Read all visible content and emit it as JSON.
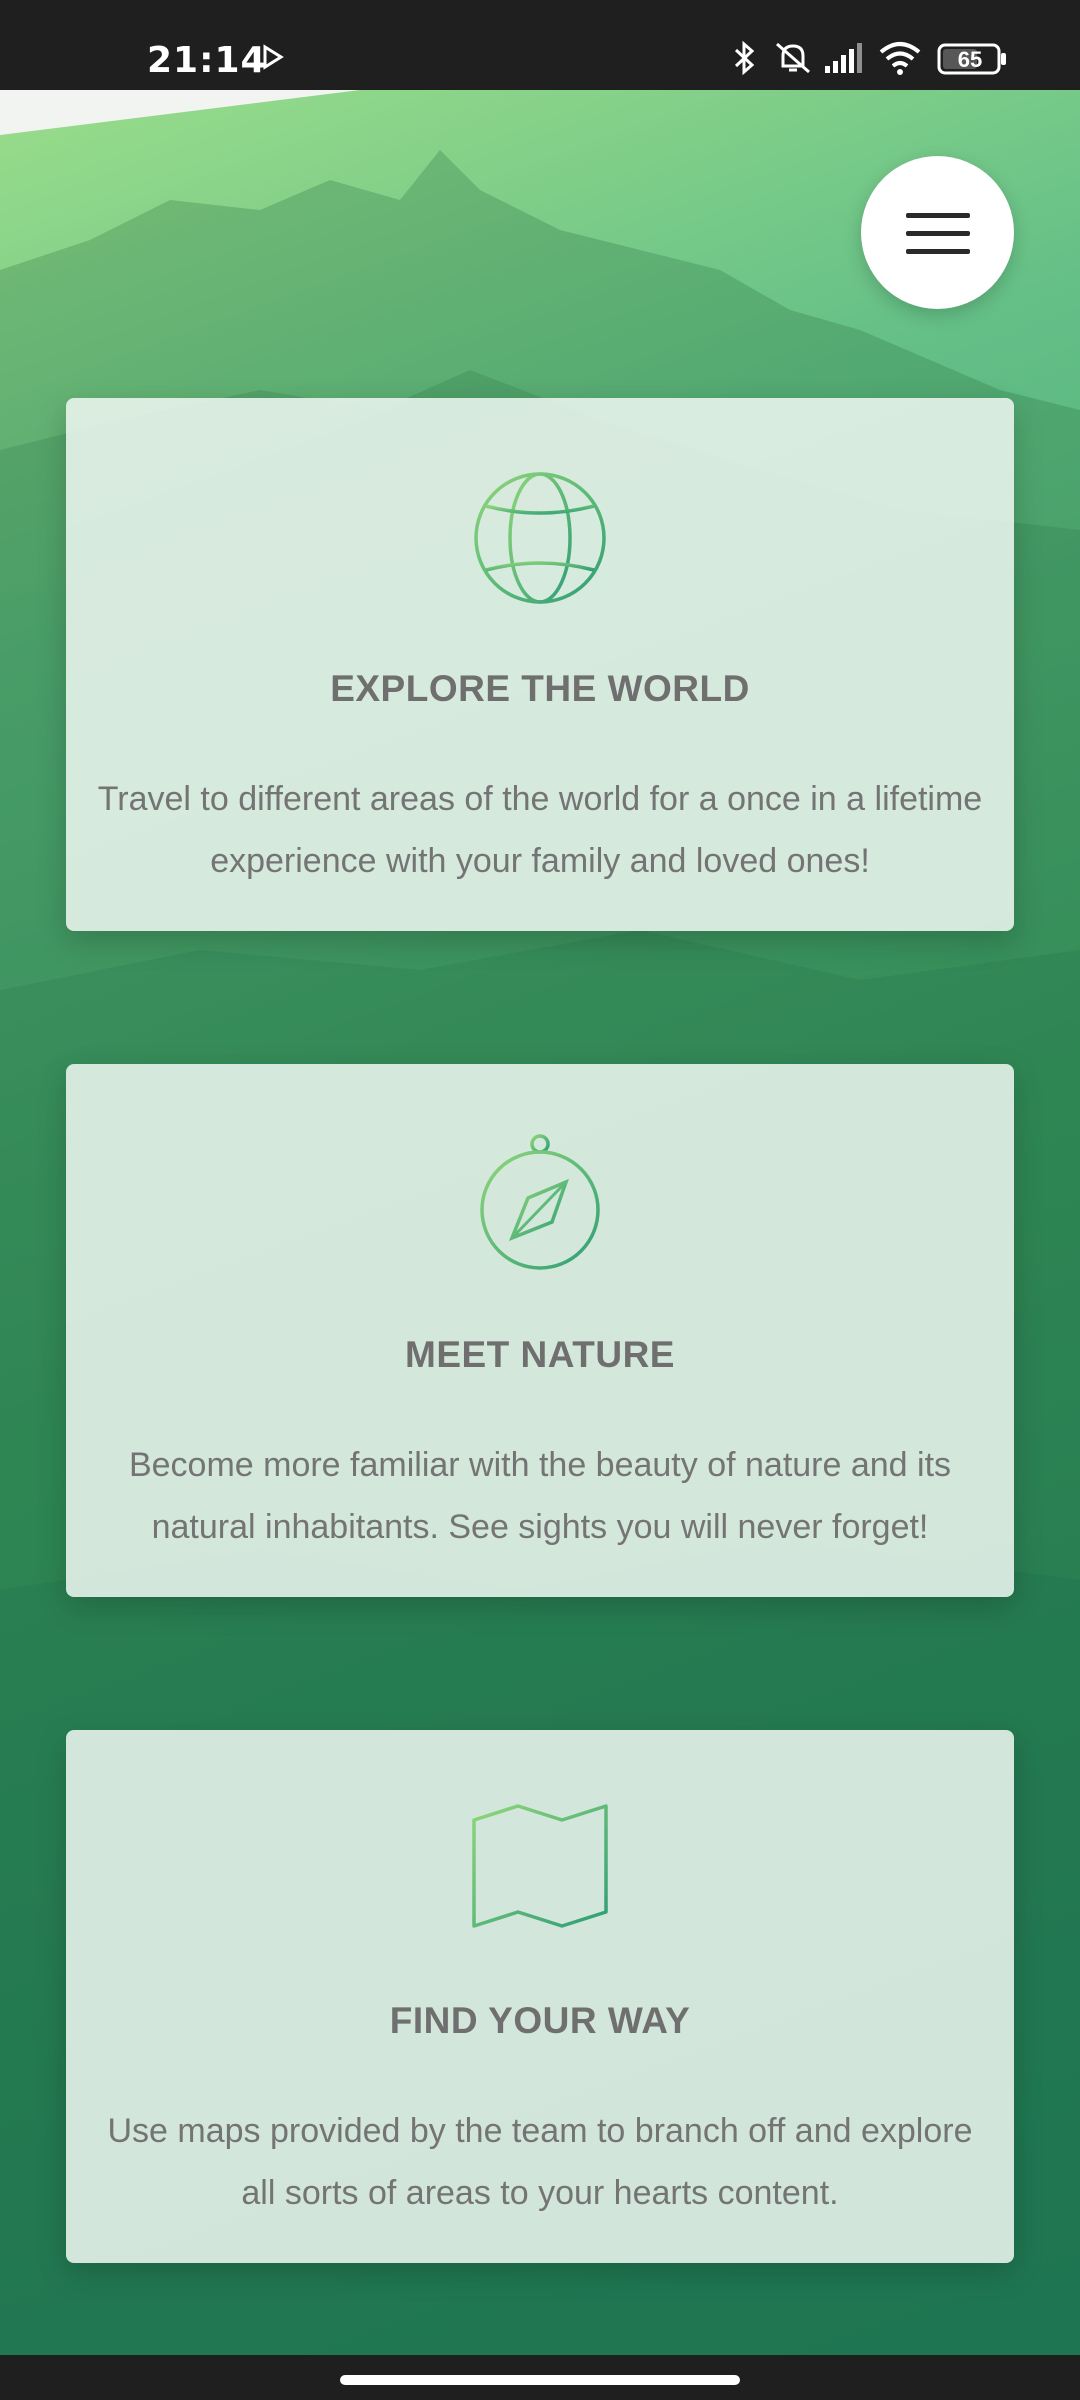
{
  "status_bar": {
    "time": "21:14",
    "battery": "65",
    "icons": [
      "play-icon",
      "bluetooth-icon",
      "mute-icon",
      "signal-icon",
      "wifi-icon",
      "battery-icon"
    ]
  },
  "header": {
    "menu_icon": "hamburger-menu-icon"
  },
  "cards": [
    {
      "icon": "globe-icon",
      "title": "EXPLORE THE WORLD",
      "body": "Travel to different areas of the world for a once in a lifetime experience with your family and loved ones!"
    },
    {
      "icon": "compass-icon",
      "title": "MEET NATURE",
      "body": "Become more familiar with the beauty of nature and its natural inhabitants. See sights you will never forget!"
    },
    {
      "icon": "map-icon",
      "title": "FIND YOUR WAY",
      "body": "Use maps provided by the team to branch off and explore all sorts of areas to your hearts content."
    }
  ],
  "colors": {
    "accent_light": "#8fd67a",
    "accent_dark": "#2f9e76",
    "card_text": "#747474"
  }
}
